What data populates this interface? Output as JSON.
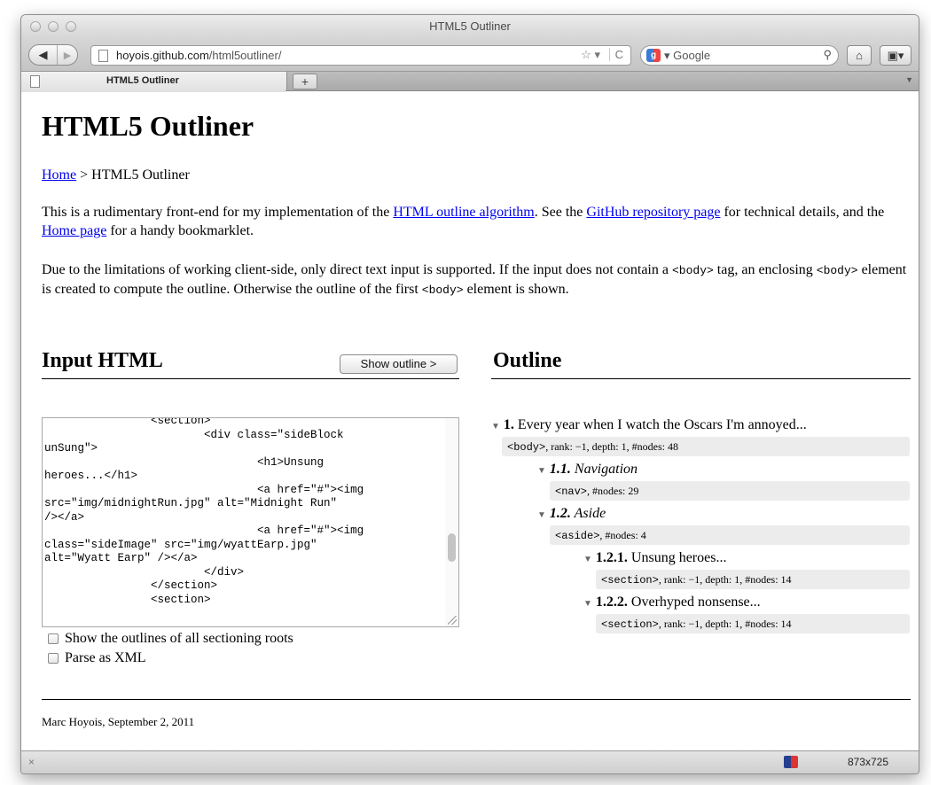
{
  "window": {
    "title": "HTML5 Outliner"
  },
  "toolbar": {
    "url_host": "hoyois.github.com",
    "url_path": "/html5outliner/",
    "url_star": "☆ ▾",
    "url_reload": "C",
    "search_engine_icon": "google-icon",
    "search_placeholder": "▾ Google"
  },
  "tabs": {
    "active_label": "HTML5 Outliner",
    "new_tab_label": "+"
  },
  "page": {
    "title": "HTML5 Outliner",
    "breadcrumb": {
      "home": "Home",
      "separator": " > ",
      "current": "HTML5 Outliner"
    },
    "intro": {
      "t1": "This is a rudimentary front-end for my implementation of the ",
      "link1": "HTML outline algorithm",
      "t2": ". See the ",
      "link2": "GitHub repository page",
      "t3": " for technical details, and the ",
      "link3": "Home page",
      "t4": " for a handy bookmarklet."
    },
    "limits": {
      "t1": "Due to the limitations of working client-side, only direct text input is supported. If the input does not contain a ",
      "code1": "<body>",
      "t2": " tag, an enclosing ",
      "code2": "<body>",
      "t3": " element is created to compute the outline. Otherwise the outline of the first ",
      "code3": "<body>",
      "t4": " element is shown."
    },
    "input": {
      "heading": "Input HTML",
      "show_button": "Show outline >",
      "code": "                <section>\n                        <div class=\"sideBlock\nunSung\">\n                                <h1>Unsung\nheroes...</h1>\n                                <a href=\"#\"><img\nsrc=\"img/midnightRun.jpg\" alt=\"Midnight Run\"\n/></a>\n                                <a href=\"#\"><img\nclass=\"sideImage\" src=\"img/wyattEarp.jpg\"\nalt=\"Wyatt Earp\" /></a>\n                        </div>\n                </section>\n                <section>",
      "opt_sectioning": "Show the outlines of all sectioning roots",
      "opt_xml": "Parse as XML"
    },
    "outline": {
      "heading": "Outline",
      "n1": {
        "num": "1.",
        "title": " Every year when I watch the Oscars I'm annoyed...",
        "tag": "<body>",
        "info": ", rank: −1, depth: 1, #nodes: 48"
      },
      "n11": {
        "num": "1.1.",
        "title": " Navigation",
        "tag": "<nav>",
        "info": ", #nodes: 29"
      },
      "n12": {
        "num": "1.2.",
        "title": " Aside",
        "tag": "<aside>",
        "info": ", #nodes: 4"
      },
      "n121": {
        "num": "1.2.1.",
        "title": " Unsung heroes...",
        "tag": "<section>",
        "info": ", rank: −1, depth: 1, #nodes: 14"
      },
      "n122": {
        "num": "1.2.2.",
        "title": " Overhyped nonsense...",
        "tag": "<section>",
        "info": ", rank: −1, depth: 1, #nodes: 14"
      }
    },
    "footer": "Marc Hoyois, September 2, 2011"
  },
  "statusbar": {
    "close": "×",
    "size": "873x725"
  }
}
